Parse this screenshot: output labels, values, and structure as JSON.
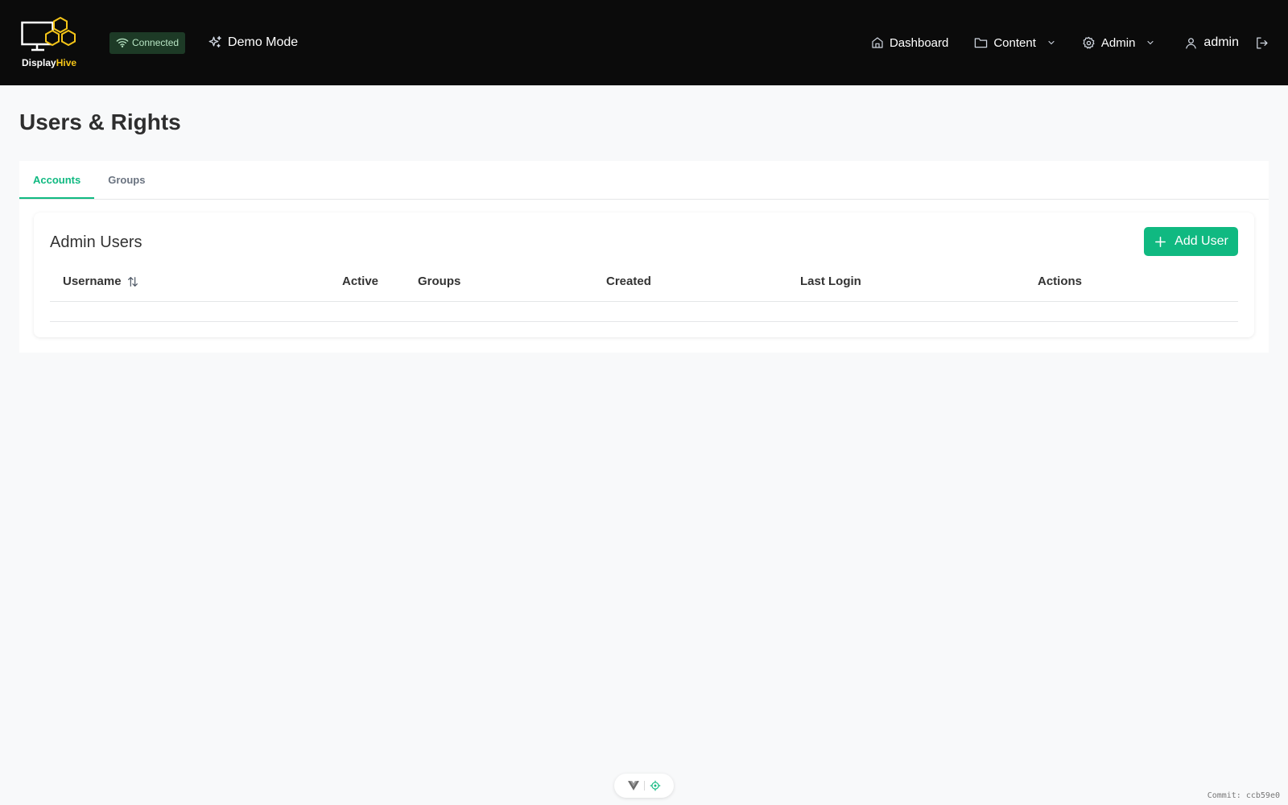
{
  "header": {
    "logo": {
      "text_primary": "Display",
      "text_accent": "Hive"
    },
    "status_badge": {
      "label": "Connected",
      "icon": "wifi-icon"
    },
    "demo_mode": {
      "label": "Demo Mode",
      "icon": "sparkles-icon"
    },
    "nav": {
      "dashboard": {
        "label": "Dashboard",
        "icon": "home-icon"
      },
      "content": {
        "label": "Content",
        "icon": "folder-icon"
      },
      "admin": {
        "label": "Admin",
        "icon": "gear-icon"
      },
      "user": {
        "label": "admin",
        "icon": "user-icon"
      },
      "logout_icon": "logout-icon"
    }
  },
  "page": {
    "title": "Users & Rights",
    "tabs": [
      {
        "label": "Accounts",
        "active": true
      },
      {
        "label": "Groups",
        "active": false
      }
    ],
    "card": {
      "title": "Admin Users",
      "add_button": "Add User",
      "columns": [
        "Username",
        "Active",
        "Groups",
        "Created",
        "Last Login",
        "Actions"
      ],
      "rows": []
    }
  },
  "footer": {
    "commit": "Commit: ccb59e0"
  },
  "colors": {
    "accent": "#10b981",
    "topbar": "#0b0b0b",
    "logo_accent": "#f5c518",
    "badge_bg": "#1d3a26"
  }
}
